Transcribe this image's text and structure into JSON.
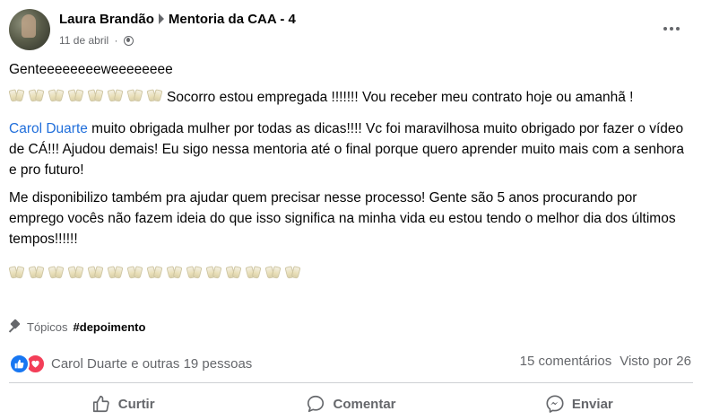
{
  "post": {
    "author": "Laura Brandão",
    "group": "Mentoria da CAA - 4",
    "date": "11 de abril",
    "separator": "·",
    "privacy_icon": "group-members-icon",
    "paragraphs": {
      "line1": "Genteeeeeeeeweeeeeeee",
      "toast_count_1": 8,
      "line2": "Socorro estou empregada !!!!!!! Vou receber meu contrato hoje ou amanhã !",
      "mention": "Carol Duarte",
      "line3": " muito obrigada mulher por todas as dicas!!!! Vc foi maravilhosa muito obrigado por fazer o vídeo de CÁ!!! Ajudou demais! Eu sigo nessa mentoria até o final porque quero aprender muito mais com a senhora e pro futuro!",
      "line4": "Me disponibilizo também pra ajudar quem precisar nesse processo! Gente são 5 anos procurando por emprego vocês não fazem ideia do que isso significa na minha vida eu estou tendo o melhor dia dos últimos tempos!!!!!!",
      "toast_count_2": 15
    },
    "topics_label": "Tópicos",
    "hashtag": "#depoimento",
    "reactions_text": "Carol Duarte e outras 19 pessoas",
    "comments_text": "15 comentários",
    "views_text": "Visto por 26",
    "actions": {
      "like": "Curtir",
      "comment": "Comentar",
      "send": "Enviar"
    },
    "colors": {
      "like_blue": "#1877f2",
      "love_red": "#f33e58",
      "mention_blue": "#216fdb",
      "secondary_text": "#65676b"
    }
  }
}
